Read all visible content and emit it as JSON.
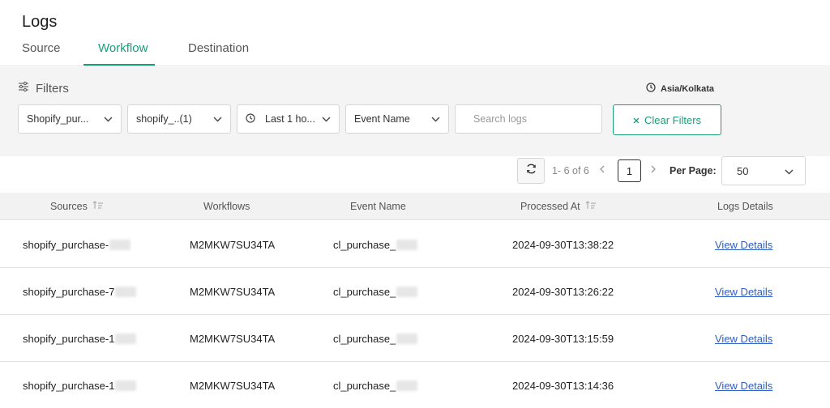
{
  "page": {
    "title": "Logs"
  },
  "tabs": [
    {
      "label": "Source"
    },
    {
      "label": "Workflow"
    },
    {
      "label": "Destination"
    }
  ],
  "filters": {
    "heading": "Filters",
    "timezone": "Asia/Kolkata",
    "source_select": "Shopify_pur...",
    "workflow_select": "shopify_..(1)",
    "time_select": "Last 1 ho...",
    "event_select": "Event Name",
    "search_placeholder": "Search logs",
    "clear_label": "Clear Filters"
  },
  "pagination": {
    "range": "1- 6 of 6",
    "current_page": "1",
    "per_page_label": "Per Page:",
    "per_page_value": "50"
  },
  "table": {
    "headers": [
      "Sources",
      "Workflows",
      "Event Name",
      "Processed At",
      "Logs Details"
    ],
    "rows": [
      {
        "source": "shopify_purchase-",
        "workflow": "M2MKW7SU34TA",
        "event": "cl_purchase_",
        "processed": "2024-09-30T13:38:22",
        "details": "View Details"
      },
      {
        "source": "shopify_purchase-7",
        "workflow": "M2MKW7SU34TA",
        "event": "cl_purchase_",
        "processed": "2024-09-30T13:26:22",
        "details": "View Details"
      },
      {
        "source": "shopify_purchase-1",
        "workflow": "M2MKW7SU34TA",
        "event": "cl_purchase_",
        "processed": "2024-09-30T13:15:59",
        "details": "View Details"
      },
      {
        "source": "shopify_purchase-1",
        "workflow": "M2MKW7SU34TA",
        "event": "cl_purchase_",
        "processed": "2024-09-30T13:14:36",
        "details": "View Details"
      }
    ]
  },
  "colors": {
    "accent": "#1a9e78",
    "link": "#2f5ec4"
  },
  "icons": {
    "filters": "sliders-icon",
    "timezone": "clock-icon",
    "time_filter": "clock-icon",
    "refresh": "refresh-icon",
    "sort": "sort-icon",
    "dropdown": "chevron-down-icon",
    "clear": "close-icon"
  }
}
